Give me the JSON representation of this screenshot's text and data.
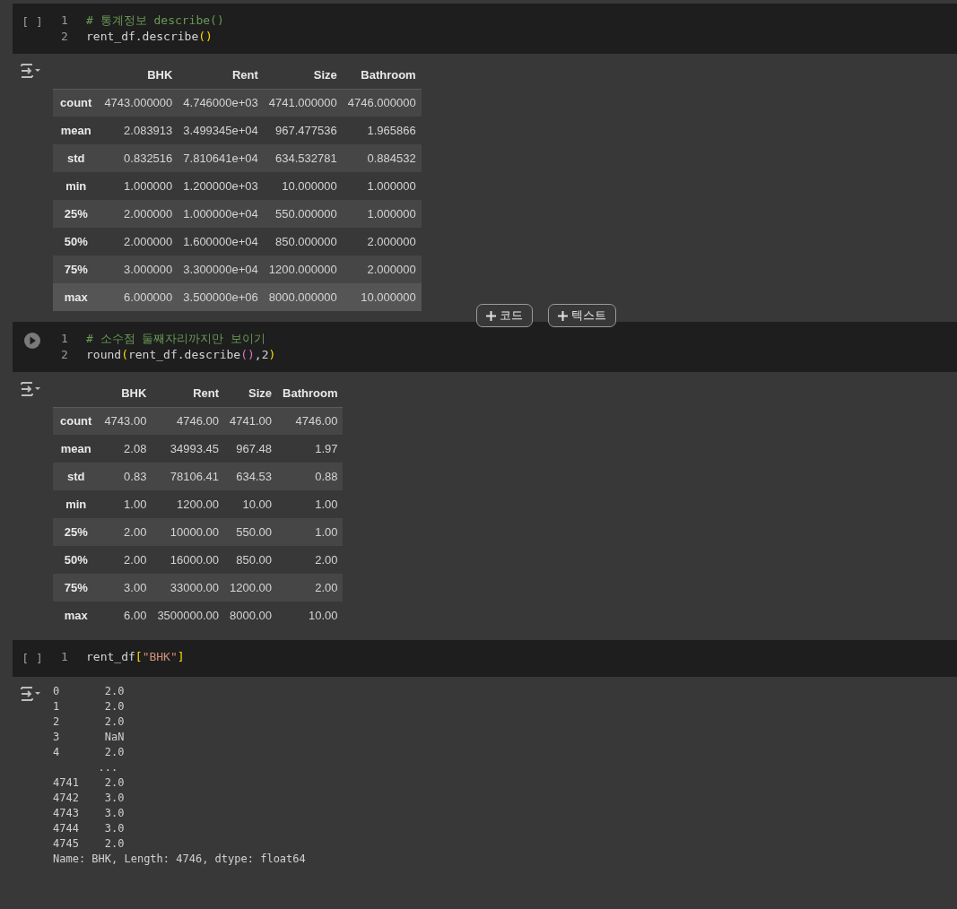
{
  "cells": [
    {
      "run": {
        "kind": "idle",
        "label": "[ ]"
      },
      "lines": [
        {
          "number": "1",
          "tokens": [
            {
              "kind": "comment",
              "text": "# 통계정보 describe()"
            }
          ]
        },
        {
          "number": "2",
          "tokens": [
            {
              "kind": "plain",
              "text": "rent_df.describe"
            },
            {
              "kind": "bracket",
              "text": "()"
            }
          ]
        }
      ],
      "output": {
        "kind": "table",
        "columns": [
          "BHK",
          "Rent",
          "Size",
          "Bathroom"
        ],
        "rows": [
          {
            "index": "count",
            "hovered": false,
            "cells": [
              "4743.000000",
              "4.746000e+03",
              "4741.000000",
              "4746.000000"
            ]
          },
          {
            "index": "mean",
            "hovered": false,
            "cells": [
              "2.083913",
              "3.499345e+04",
              "967.477536",
              "1.965866"
            ]
          },
          {
            "index": "std",
            "hovered": false,
            "cells": [
              "0.832516",
              "7.810641e+04",
              "634.532781",
              "0.884532"
            ]
          },
          {
            "index": "min",
            "hovered": false,
            "cells": [
              "1.000000",
              "1.200000e+03",
              "10.000000",
              "1.000000"
            ]
          },
          {
            "index": "25%",
            "hovered": false,
            "cells": [
              "2.000000",
              "1.000000e+04",
              "550.000000",
              "1.000000"
            ]
          },
          {
            "index": "50%",
            "hovered": false,
            "cells": [
              "2.000000",
              "1.600000e+04",
              "850.000000",
              "2.000000"
            ]
          },
          {
            "index": "75%",
            "hovered": false,
            "cells": [
              "3.000000",
              "3.300000e+04",
              "1200.000000",
              "2.000000"
            ]
          },
          {
            "index": "max",
            "hovered": true,
            "cells": [
              "6.000000",
              "3.500000e+06",
              "8000.000000",
              "10.000000"
            ]
          }
        ]
      },
      "add_buttons": [
        {
          "label": "코드"
        },
        {
          "label": "텍스트"
        }
      ]
    },
    {
      "run": {
        "kind": "play"
      },
      "lines": [
        {
          "number": "1",
          "tokens": [
            {
              "kind": "comment",
              "text": "# 소수점 둘째자리까지만 보이기"
            }
          ]
        },
        {
          "number": "2",
          "tokens": [
            {
              "kind": "plain",
              "text": "round"
            },
            {
              "kind": "bracket",
              "text": "("
            },
            {
              "kind": "plain",
              "text": "rent_df.describe"
            },
            {
              "kind": "bracket2",
              "text": "()"
            },
            {
              "kind": "plain",
              "text": ",2"
            },
            {
              "kind": "bracket",
              "text": ")"
            }
          ]
        }
      ],
      "output": {
        "kind": "table",
        "columns": [
          "BHK",
          "Rent",
          "Size",
          "Bathroom"
        ],
        "rows": [
          {
            "index": "count",
            "hovered": false,
            "cells": [
              "4743.00",
              "4746.00",
              "4741.00",
              "4746.00"
            ]
          },
          {
            "index": "mean",
            "hovered": false,
            "cells": [
              "2.08",
              "34993.45",
              "967.48",
              "1.97"
            ]
          },
          {
            "index": "std",
            "hovered": false,
            "cells": [
              "0.83",
              "78106.41",
              "634.53",
              "0.88"
            ]
          },
          {
            "index": "min",
            "hovered": false,
            "cells": [
              "1.00",
              "1200.00",
              "10.00",
              "1.00"
            ]
          },
          {
            "index": "25%",
            "hovered": false,
            "cells": [
              "2.00",
              "10000.00",
              "550.00",
              "1.00"
            ]
          },
          {
            "index": "50%",
            "hovered": false,
            "cells": [
              "2.00",
              "16000.00",
              "850.00",
              "2.00"
            ]
          },
          {
            "index": "75%",
            "hovered": false,
            "cells": [
              "3.00",
              "33000.00",
              "1200.00",
              "2.00"
            ]
          },
          {
            "index": "max",
            "hovered": false,
            "cells": [
              "6.00",
              "3500000.00",
              "8000.00",
              "10.00"
            ]
          }
        ]
      }
    },
    {
      "run": {
        "kind": "idle",
        "label": "[ ]"
      },
      "lines": [
        {
          "number": "1",
          "tokens": [
            {
              "kind": "plain",
              "text": "rent_df"
            },
            {
              "kind": "bracket",
              "text": "["
            },
            {
              "kind": "string",
              "text": "\"BHK\""
            },
            {
              "kind": "bracket",
              "text": "]"
            }
          ]
        }
      ],
      "output": {
        "kind": "text",
        "lines": [
          "0       2.0",
          "1       2.0",
          "2       2.0",
          "3       NaN",
          "4       2.0",
          "       ...",
          "4741    2.0",
          "4742    3.0",
          "4743    3.0",
          "4744    3.0",
          "4745    2.0",
          "Name: BHK, Length: 4746, dtype: float64"
        ]
      }
    }
  ]
}
